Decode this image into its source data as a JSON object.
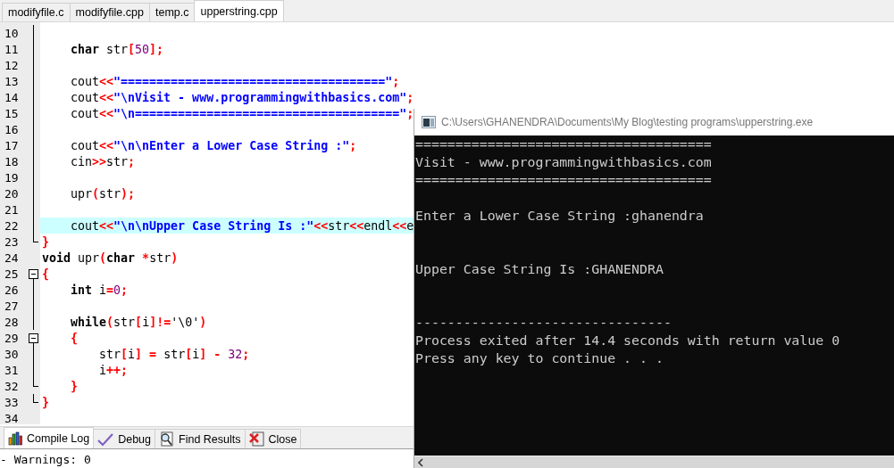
{
  "editor_tabs": [
    {
      "label": "modifyfile.c",
      "selected": false
    },
    {
      "label": "modifyfile.cpp",
      "selected": false
    },
    {
      "label": "temp.c",
      "selected": false
    },
    {
      "label": "upperstring.cpp",
      "selected": true
    }
  ],
  "code_lines": [
    {
      "number": "10",
      "kind": "fold_body",
      "highlighted": false
    },
    {
      "number": "11",
      "kind": "fold_body",
      "highlighted": false,
      "tokens": [
        {
          "kind": "keyword",
          "text": "    char"
        },
        {
          "kind": "plain",
          "text": " str"
        },
        {
          "kind": "operator",
          "text": "["
        },
        {
          "kind": "number",
          "text": "50"
        },
        {
          "kind": "operator",
          "text": "];"
        }
      ]
    },
    {
      "number": "12",
      "kind": "fold_body",
      "highlighted": false
    },
    {
      "number": "13",
      "kind": "fold_body",
      "highlighted": false,
      "tokens": [
        {
          "kind": "plain",
          "text": "    cout"
        },
        {
          "kind": "operator",
          "text": "<<"
        },
        {
          "kind": "string",
          "text": "\"=====================================\""
        },
        {
          "kind": "operator",
          "text": ";"
        }
      ]
    },
    {
      "number": "14",
      "kind": "fold_body",
      "highlighted": false,
      "tokens": [
        {
          "kind": "plain",
          "text": "    cout"
        },
        {
          "kind": "operator",
          "text": "<<"
        },
        {
          "kind": "string",
          "text": "\"\\nVisit - www.programmingwithbasics.com\""
        },
        {
          "kind": "operator",
          "text": ";"
        }
      ]
    },
    {
      "number": "15",
      "kind": "fold_body",
      "highlighted": false,
      "tokens": [
        {
          "kind": "plain",
          "text": "    cout"
        },
        {
          "kind": "operator",
          "text": "<<"
        },
        {
          "kind": "string",
          "text": "\"\\n=====================================\""
        },
        {
          "kind": "operator",
          "text": ";"
        }
      ]
    },
    {
      "number": "16",
      "kind": "fold_body",
      "highlighted": false
    },
    {
      "number": "17",
      "kind": "fold_body",
      "highlighted": false,
      "tokens": [
        {
          "kind": "plain",
          "text": "    cout"
        },
        {
          "kind": "operator",
          "text": "<<"
        },
        {
          "kind": "string",
          "text": "\"\\n\\nEnter a Lower Case String :\""
        },
        {
          "kind": "operator",
          "text": ";"
        }
      ]
    },
    {
      "number": "18",
      "kind": "fold_body",
      "highlighted": false,
      "tokens": [
        {
          "kind": "plain",
          "text": "    cin"
        },
        {
          "kind": "operator",
          "text": ">>"
        },
        {
          "kind": "plain",
          "text": "str"
        },
        {
          "kind": "operator",
          "text": ";"
        }
      ]
    },
    {
      "number": "19",
      "kind": "fold_body",
      "highlighted": false
    },
    {
      "number": "20",
      "kind": "fold_body",
      "highlighted": false,
      "tokens": [
        {
          "kind": "plain",
          "text": "    upr"
        },
        {
          "kind": "operator",
          "text": "("
        },
        {
          "kind": "plain",
          "text": "str"
        },
        {
          "kind": "operator",
          "text": ");"
        }
      ]
    },
    {
      "number": "21",
      "kind": "fold_body",
      "highlighted": false
    },
    {
      "number": "22",
      "kind": "fold_body",
      "highlighted": true,
      "tokens": [
        {
          "kind": "plain",
          "text": "    cout"
        },
        {
          "kind": "operator",
          "text": "<<"
        },
        {
          "kind": "string",
          "text": "\"\\n\\nUpper Case String Is :\""
        },
        {
          "kind": "operator",
          "text": "<<"
        },
        {
          "kind": "plain",
          "text": "str"
        },
        {
          "kind": "operator",
          "text": "<<"
        },
        {
          "kind": "plain",
          "text": "endl"
        },
        {
          "kind": "operator",
          "text": "<<"
        },
        {
          "kind": "plain",
          "text": "e"
        }
      ]
    },
    {
      "number": "23",
      "kind": "fold_end",
      "highlighted": false,
      "tokens": [
        {
          "kind": "operator",
          "text": "}"
        }
      ]
    },
    {
      "number": "24",
      "kind": "plain",
      "highlighted": false,
      "tokens": [
        {
          "kind": "keyword",
          "text": "void"
        },
        {
          "kind": "plain",
          "text": " upr"
        },
        {
          "kind": "operator",
          "text": "("
        },
        {
          "kind": "keyword",
          "text": "char"
        },
        {
          "kind": "operator",
          "text": " *"
        },
        {
          "kind": "plain",
          "text": "str"
        },
        {
          "kind": "operator",
          "text": ")"
        }
      ]
    },
    {
      "number": "25",
      "kind": "fold_start",
      "highlighted": false,
      "tokens": [
        {
          "kind": "operator",
          "text": "{"
        }
      ]
    },
    {
      "number": "26",
      "kind": "fold_body",
      "highlighted": false,
      "tokens": [
        {
          "kind": "keyword",
          "text": "    int"
        },
        {
          "kind": "plain",
          "text": " i"
        },
        {
          "kind": "operator",
          "text": "="
        },
        {
          "kind": "number",
          "text": "0"
        },
        {
          "kind": "operator",
          "text": ";"
        }
      ]
    },
    {
      "number": "27",
      "kind": "fold_body",
      "highlighted": false
    },
    {
      "number": "28",
      "kind": "fold_body",
      "highlighted": false,
      "tokens": [
        {
          "kind": "keyword",
          "text": "    while"
        },
        {
          "kind": "operator",
          "text": "("
        },
        {
          "kind": "plain",
          "text": "str"
        },
        {
          "kind": "operator",
          "text": "["
        },
        {
          "kind": "plain",
          "text": "i"
        },
        {
          "kind": "operator",
          "text": "]!="
        },
        {
          "kind": "plain",
          "text": "'\\0'"
        },
        {
          "kind": "operator",
          "text": ")"
        }
      ]
    },
    {
      "number": "29",
      "kind": "fold_start",
      "highlighted": false,
      "tokens": [
        {
          "kind": "operator",
          "text": "    {"
        }
      ]
    },
    {
      "number": "30",
      "kind": "fold_body",
      "highlighted": false,
      "tokens": [
        {
          "kind": "plain",
          "text": "        str"
        },
        {
          "kind": "operator",
          "text": "["
        },
        {
          "kind": "plain",
          "text": "i"
        },
        {
          "kind": "operator",
          "text": "]"
        },
        {
          "kind": "operator",
          "text": " ="
        },
        {
          "kind": "plain",
          "text": " str"
        },
        {
          "kind": "operator",
          "text": "["
        },
        {
          "kind": "plain",
          "text": "i"
        },
        {
          "kind": "operator",
          "text": "]"
        },
        {
          "kind": "operator",
          "text": " -"
        },
        {
          "kind": "number",
          "text": " 32"
        },
        {
          "kind": "operator",
          "text": ";"
        }
      ]
    },
    {
      "number": "31",
      "kind": "fold_body",
      "highlighted": false,
      "tokens": [
        {
          "kind": "plain",
          "text": "        i"
        },
        {
          "kind": "operator",
          "text": "++;"
        }
      ]
    },
    {
      "number": "32",
      "kind": "fold_end",
      "highlighted": false,
      "tokens": [
        {
          "kind": "operator",
          "text": "    }"
        }
      ]
    },
    {
      "number": "33",
      "kind": "fold_end",
      "highlighted": false,
      "tokens": [
        {
          "kind": "operator",
          "text": "}"
        }
      ]
    },
    {
      "number": "34",
      "kind": "plain",
      "highlighted": false
    }
  ],
  "bottom_tabs": [
    {
      "label": "Compile Log",
      "kind": "chart",
      "selected": true
    },
    {
      "label": "Debug",
      "kind": "check",
      "selected": false
    },
    {
      "label": "Find Results",
      "kind": "find",
      "selected": false
    },
    {
      "label": "Close",
      "kind": "close",
      "selected": false
    }
  ],
  "log_text": "- Warnings: 0",
  "console": {
    "title": "C:\\Users\\GHANENDRA\\Documents\\My Blog\\testing programs\\upperstring.exe",
    "lines": [
      {
        "kind": "text",
        "text": "====================================="
      },
      {
        "kind": "text",
        "text": "Visit - www.programmingwithbasics.com"
      },
      {
        "kind": "text",
        "text": "====================================="
      },
      {
        "kind": "blank"
      },
      {
        "kind": "text",
        "text": "Enter a Lower Case String :ghanendra"
      },
      {
        "kind": "blank"
      },
      {
        "kind": "blank"
      },
      {
        "kind": "text",
        "text": "Upper Case String Is :GHANENDRA"
      },
      {
        "kind": "blank"
      },
      {
        "kind": "blank"
      },
      {
        "kind": "text",
        "text": "--------------------------------"
      },
      {
        "kind": "text",
        "text": "Process exited after 14.4 seconds with return value 0"
      },
      {
        "kind": "text",
        "text": "Press any key to continue . . ."
      }
    ]
  }
}
